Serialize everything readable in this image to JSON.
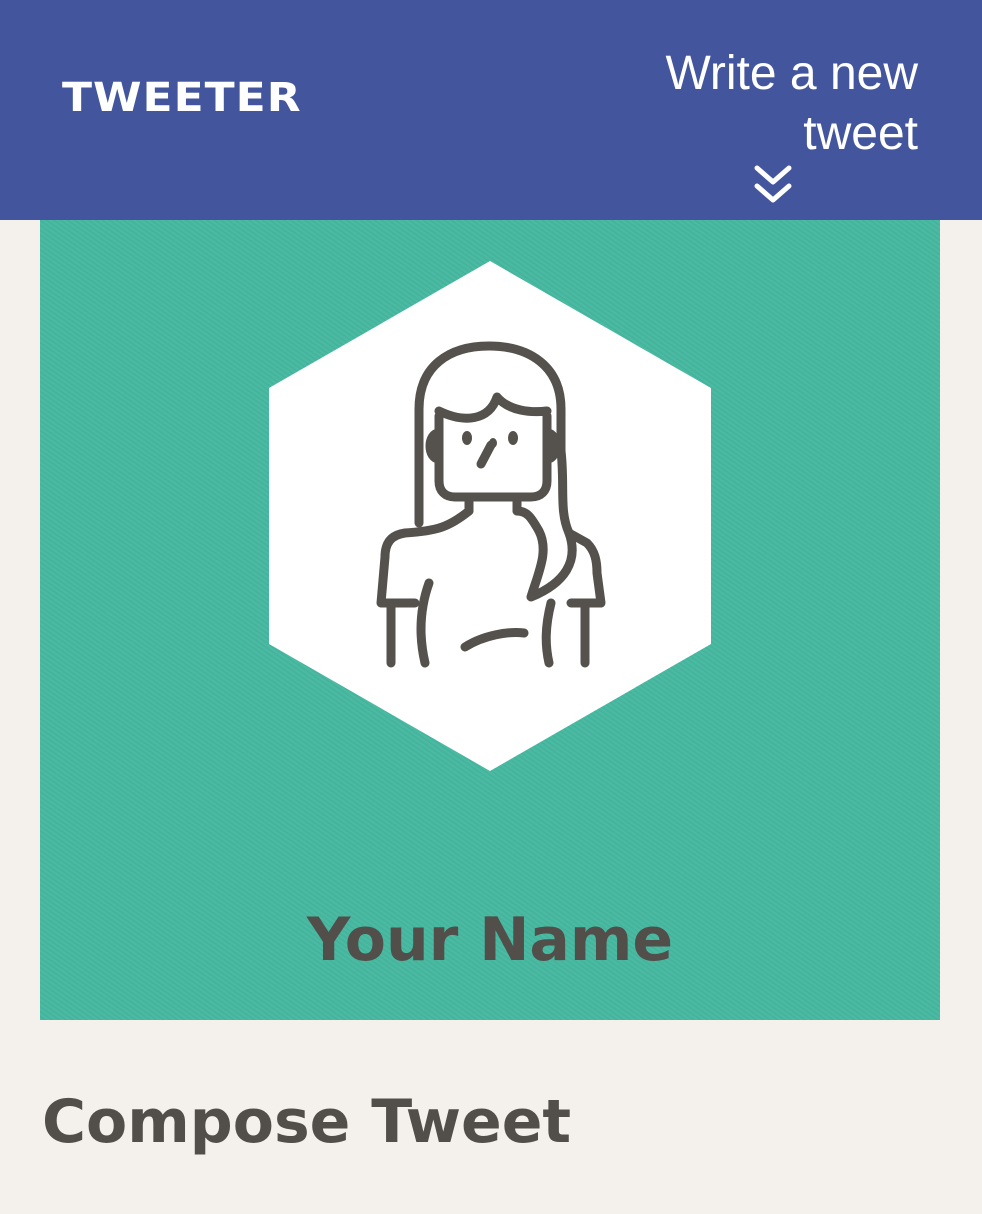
{
  "navbar": {
    "logo_text": "TWEETER",
    "cta_label": "Write a new tweet",
    "cta_icon": "chevrons-down-icon",
    "background_color": "#43569d"
  },
  "profile": {
    "name": "Your Name",
    "avatar_icon": "user-avatar-icon",
    "card_color": "#45b8a0"
  },
  "compose": {
    "title": "Compose Tweet"
  },
  "colors": {
    "page_background": "#f4f1ec",
    "text_dark": "#524e4a"
  }
}
